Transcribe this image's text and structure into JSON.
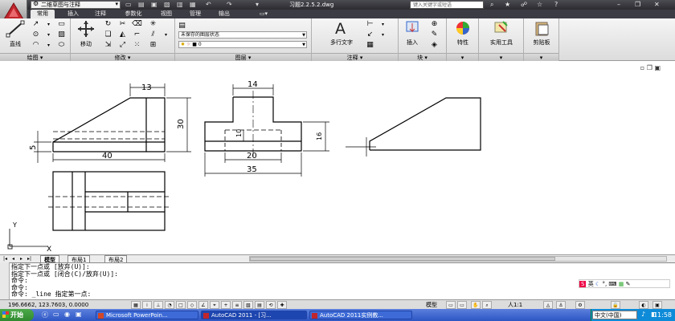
{
  "titlebar": {
    "workspace": "二维草图与注释",
    "doc_title": "习题2.2.5.2.dwg",
    "search_placeholder": "键入关键字或短语"
  },
  "tabs": [
    "常用",
    "插入",
    "注释",
    "参数化",
    "视图",
    "管理",
    "输出"
  ],
  "ribbon": {
    "draw": {
      "label": "绘图",
      "line": "直线"
    },
    "modify": {
      "label": "修改",
      "move": "移动"
    },
    "layers": {
      "label": "图层",
      "state": "未保存的图层状态",
      "current": "0"
    },
    "annotation": {
      "label": "注释",
      "mtext": "多行文字"
    },
    "block": {
      "label": "块",
      "insert": "插入"
    },
    "properties": {
      "label": "特性"
    },
    "utilities": {
      "label": "实用工具"
    },
    "clipboard": {
      "label": "剪贴板"
    }
  },
  "dims": {
    "top_width": "13",
    "height": "30",
    "base_height": "5",
    "bottom_width": "40",
    "front_top": "14",
    "front_mid": "10",
    "front_inner": "20",
    "front_total": "35",
    "front_side": "16"
  },
  "ucs": {
    "y": "Y",
    "x": "X"
  },
  "layout_tabs": [
    "模型",
    "布局1",
    "布局2"
  ],
  "command_lines": [
    "指定下一点或 [放弃(U)]:",
    "指定下一点或 [闭合(C)/放弃(U)]:",
    "命令:",
    "命令:",
    "命令: _line 指定第一点:"
  ],
  "ime": {
    "label": "英"
  },
  "status": {
    "coords": "196.6662, 123.7603, 0.0000",
    "model": "模型",
    "scale": "人1:1"
  },
  "taskbar": {
    "start": "开始",
    "tasks": [
      "Microsoft PowerPoin...",
      "AutoCAD 2011 - [习...",
      "AutoCAD 2011实例教..."
    ],
    "lang": "中文(中国)",
    "clock": "11:58"
  },
  "colors": {
    "titlebar": "#2b2b30",
    "ribbon": "#e4e4e4",
    "taskbar": "#2d56c4",
    "accent_red": "#c0262c"
  }
}
